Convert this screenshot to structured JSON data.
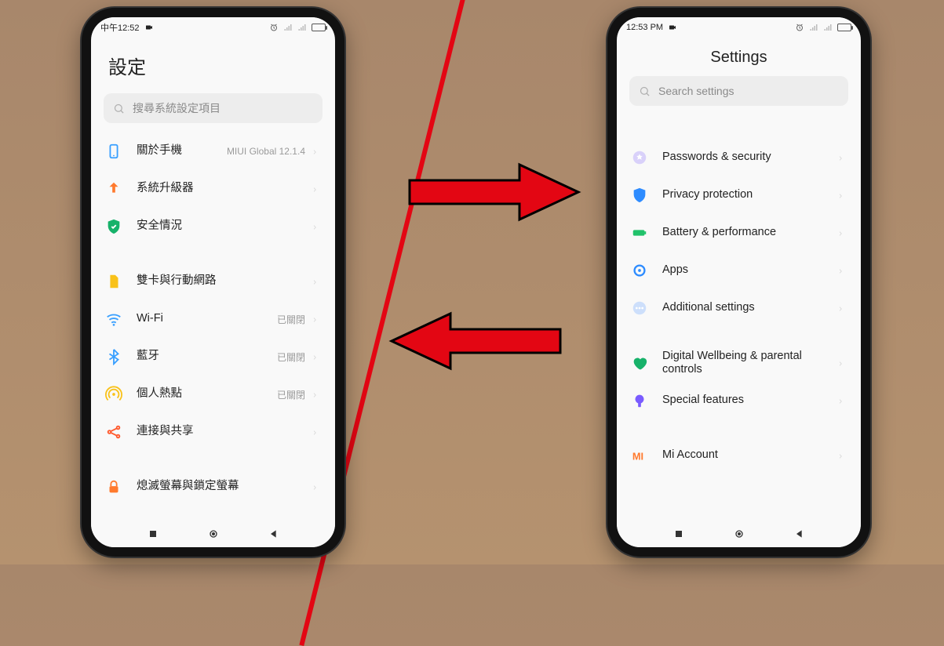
{
  "leftPhone": {
    "statusbar": {
      "time": "中午12:52"
    },
    "title": "設定",
    "searchPlaceholder": "搜尋系統設定項目",
    "groups": [
      [
        {
          "icon": "about",
          "iconColor": "#3aa0ff",
          "label": "關於手機",
          "value": "MIUI Global 12.1.4"
        },
        {
          "icon": "update",
          "iconColor": "#ff7a2e",
          "label": "系統升級器",
          "value": ""
        },
        {
          "icon": "security",
          "iconColor": "#17b26a",
          "label": "安全情況",
          "value": ""
        }
      ],
      [
        {
          "icon": "sim",
          "iconColor": "#f9c21a",
          "label": "雙卡與行動網路",
          "value": ""
        },
        {
          "icon": "wifi",
          "iconColor": "#3aa0ff",
          "label": "Wi-Fi",
          "value": "已關閉"
        },
        {
          "icon": "bluetooth",
          "iconColor": "#3aa0ff",
          "label": "藍牙",
          "value": "已關閉"
        },
        {
          "icon": "hotspot",
          "iconColor": "#f9c21a",
          "label": "個人熱點",
          "value": "已關閉"
        },
        {
          "icon": "share",
          "iconColor": "#ff5a2e",
          "label": "連接與共享",
          "value": ""
        }
      ],
      [
        {
          "icon": "lock",
          "iconColor": "#ff7a2e",
          "label": "熄滅螢幕與鎖定螢幕",
          "value": ""
        }
      ]
    ]
  },
  "rightPhone": {
    "statusbar": {
      "time": "12:53 PM"
    },
    "title": "Settings",
    "searchPlaceholder": "Search settings",
    "groups": [
      [
        {
          "icon": "password",
          "iconColor": "#7a5cff",
          "label": "Passwords & security",
          "value": ""
        },
        {
          "icon": "privacy",
          "iconColor": "#2e8cff",
          "label": "Privacy protection",
          "value": ""
        },
        {
          "icon": "battery",
          "iconColor": "#21c26a",
          "label": "Battery & performance",
          "value": ""
        },
        {
          "icon": "apps",
          "iconColor": "#2e8cff",
          "label": "Apps",
          "value": ""
        },
        {
          "icon": "more",
          "iconColor": "#7ab0ff",
          "label": "Additional settings",
          "value": ""
        }
      ],
      [
        {
          "icon": "wellbeing",
          "iconColor": "#17b26a",
          "label": "Digital Wellbeing & parental controls",
          "value": ""
        },
        {
          "icon": "special",
          "iconColor": "#7a5cff",
          "label": "Special features",
          "value": ""
        }
      ],
      [
        {
          "icon": "mi",
          "iconColor": "#ff7a2e",
          "label": "Mi Account",
          "value": ""
        }
      ]
    ]
  },
  "nav": {
    "recents": "■",
    "home": "●",
    "back": "◀"
  }
}
